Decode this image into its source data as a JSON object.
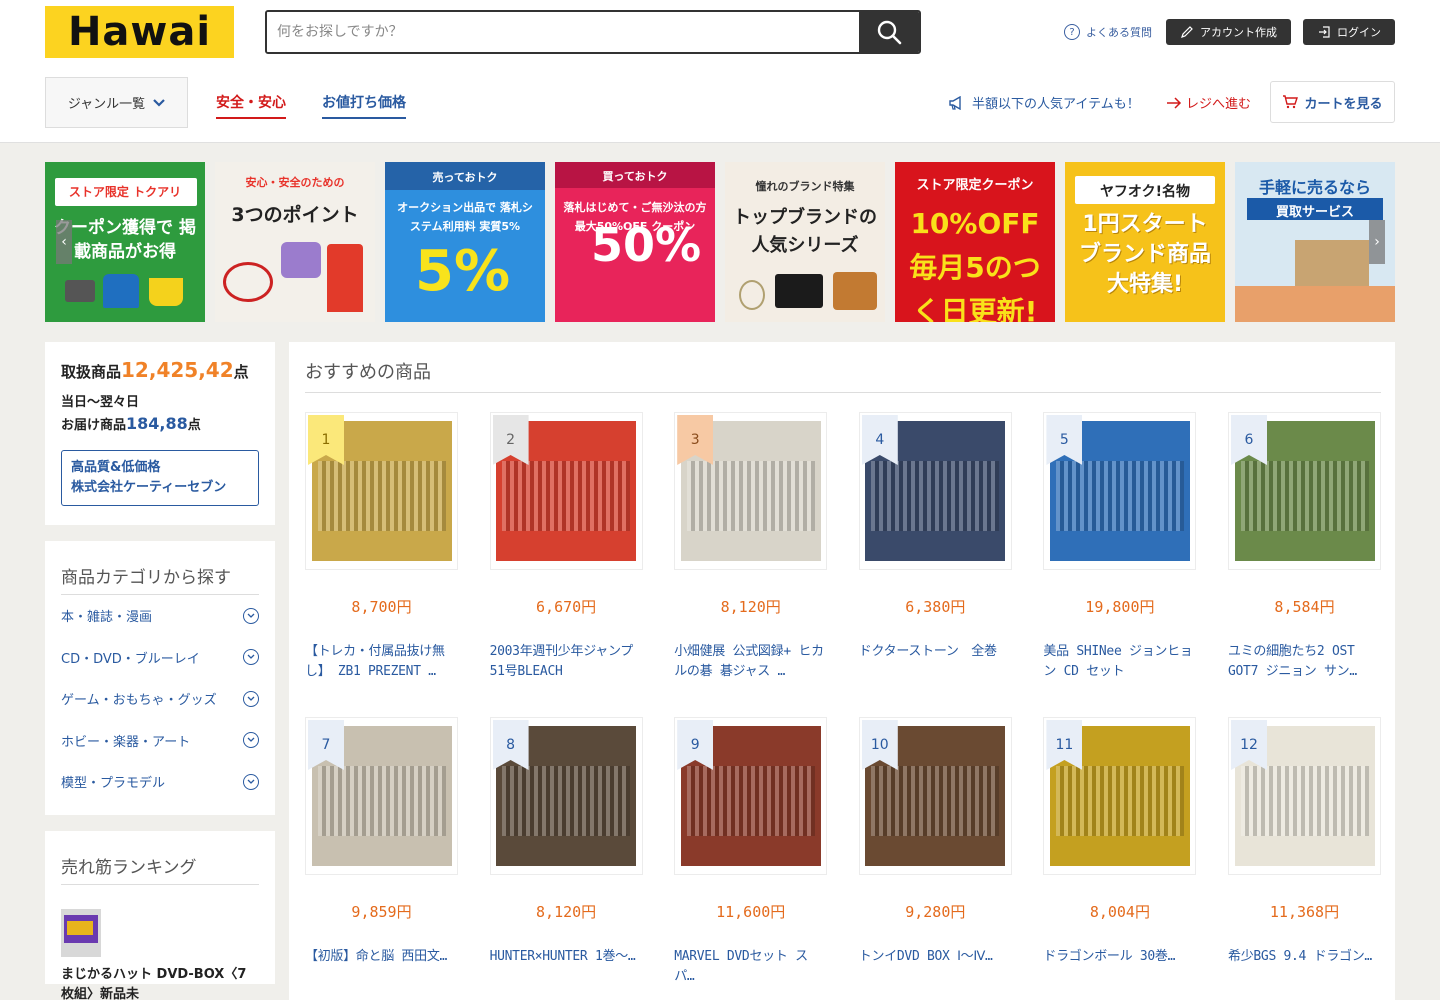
{
  "header": {
    "logo": "Hawai",
    "search_placeholder": "何をお探しですか？",
    "faq": "よくある質問",
    "signup": "アカウント作成",
    "login": "ログイン",
    "genre": "ジャンル一覧",
    "tab_safe": "安全・安心",
    "tab_deal": "お値打ち価格",
    "promo": "半額以下の人気アイテムも！",
    "checkout": "レジへ進む",
    "cart": "カートを見る"
  },
  "banners": [
    {
      "label": "ストア限定 トクアリ",
      "sub": "クーポン獲得で 掲載商品がお得",
      "bg": "#2e9b3e"
    },
    {
      "label": "安心・安全のための",
      "sub": "3つのポイント",
      "bg": "#f3f0ea"
    },
    {
      "label": "売っておトク",
      "sub": "オークション出品で 落札システム利用料 実質5%",
      "bg": "#2e8fde"
    },
    {
      "label": "買っておトク",
      "sub": "落札はじめて・ご無沙汰の方 最大50%OFF クーポン",
      "bg": "#e8245a"
    },
    {
      "label": "憧れのブランド特集",
      "sub": "トップブランドの 人気シリーズ",
      "bg": "#f3ede4"
    },
    {
      "label": "ストア限定クーポン",
      "sub": "10%OFF 毎月5のつく日更新!",
      "bg": "#d8141c"
    },
    {
      "label": "ヤフオク!名物",
      "sub": "1円スタート ブランド商品 大特集!",
      "bg": "#f6c21a"
    },
    {
      "label": "手軽に売るなら",
      "sub": "買取サービス",
      "bg": "#d8e8f2"
    }
  ],
  "stats": {
    "label1": "取扱商品",
    "count1": "12,425,42",
    "unit": "点",
    "line2": "当日〜翌々日",
    "label3": "お届け商品",
    "count3": "184,88",
    "seller_line1": "高品質&低価格",
    "seller_line2": "株式会社ケーティーセブン"
  },
  "categories": {
    "title": "商品カテゴリから探す",
    "items": [
      "本・雑誌・漫画",
      "CD・DVD・ブルーレイ",
      "ゲーム・おもちゃ・グッズ",
      "ホビー・楽器・アート",
      "模型・プラモデル"
    ]
  },
  "ranking": {
    "title": "売れ筋ランキング",
    "item": "まじかるハット DVD-BOX〈7枚組〉新品未"
  },
  "main": {
    "title": "おすすめの商品",
    "products": [
      {
        "rank": "1",
        "price": "8,700円",
        "name": "【トレカ・付属品抜け無し】 ZB1 PREZENT …",
        "color": "#c9a84a"
      },
      {
        "rank": "2",
        "price": "6,670円",
        "name": "2003年週刊少年ジャンプ 51号BLEACH",
        "color": "#d6402f"
      },
      {
        "rank": "3",
        "price": "8,120円",
        "name": "小畑健展 公式図録+ ヒカルの碁 碁ジャス …",
        "color": "#d8d4c9"
      },
      {
        "rank": "4",
        "price": "6,380円",
        "name": "ドクターストーン　全巻",
        "color": "#3a4a6a"
      },
      {
        "rank": "5",
        "price": "19,800円",
        "name": "美品 SHINee ジョンヒョン CD セット",
        "color": "#2f6fb8"
      },
      {
        "rank": "6",
        "price": "8,584円",
        "name": "ユミの細胞たち2 OST GOT7 ジニョン サン…",
        "color": "#6b8a4a"
      },
      {
        "rank": "7",
        "price": "9,859円",
        "name": "【初版】命と脳 西田文…",
        "color": "#c8c0b0"
      },
      {
        "rank": "8",
        "price": "8,120円",
        "name": "HUNTER×HUNTER 1巻〜…",
        "color": "#5a4a3a"
      },
      {
        "rank": "9",
        "price": "11,600円",
        "name": "MARVEL DVDセット スパ…",
        "color": "#8a3a2a"
      },
      {
        "rank": "10",
        "price": "9,280円",
        "name": "トンイDVD BOX Ⅰ〜Ⅳ…",
        "color": "#6a4a32"
      },
      {
        "rank": "11",
        "price": "8,004円",
        "name": "ドラゴンボール 30巻…",
        "color": "#c4a020"
      },
      {
        "rank": "12",
        "price": "11,368円",
        "name": "希少BGS 9.4 ドラゴン…",
        "color": "#e8e4d8"
      }
    ]
  }
}
